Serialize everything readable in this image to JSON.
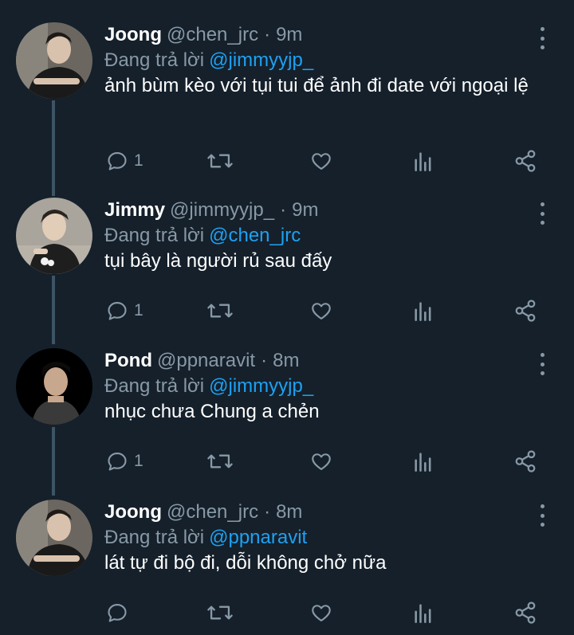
{
  "colors": {
    "background": "#15202b",
    "secondary_text": "#8899a6",
    "mention": "#1da1f2",
    "thread_line": "#3d5466"
  },
  "reply_prefix": "Đang trả lời",
  "tweets": [
    {
      "name": "Joong",
      "handle": "@chen_jrc",
      "dot": "·",
      "time": "9m",
      "reply_to": "@jimmyyjp_",
      "text": "ảnh bùm kèo với tụi tui để ảnh đi date với ngoại lệ",
      "reply_count": "1",
      "avatar_icon": "avatar-photo"
    },
    {
      "name": "Jimmy",
      "handle": "@jimmyyjp_",
      "dot": "·",
      "time": "9m",
      "reply_to": "@chen_jrc",
      "text": "tụi bây là người rủ sau đấy",
      "reply_count": "1",
      "avatar_icon": "avatar-photo"
    },
    {
      "name": "Pond",
      "handle": "@ppnaravit",
      "dot": "·",
      "time": "8m",
      "reply_to": "@jimmyyjp_",
      "text": "nhục chưa Chung a chẻn",
      "reply_count": "1",
      "avatar_icon": "avatar-photo"
    },
    {
      "name": "Joong",
      "handle": "@chen_jrc",
      "dot": "·",
      "time": "8m",
      "reply_to": "@ppnaravit",
      "text": "lát tự đi bộ đi, dỗi không chở nữa",
      "reply_count": "",
      "avatar_icon": "avatar-photo"
    }
  ],
  "action_icons": [
    "reply-icon",
    "retweet-icon",
    "like-icon",
    "analytics-icon",
    "share-icon"
  ]
}
